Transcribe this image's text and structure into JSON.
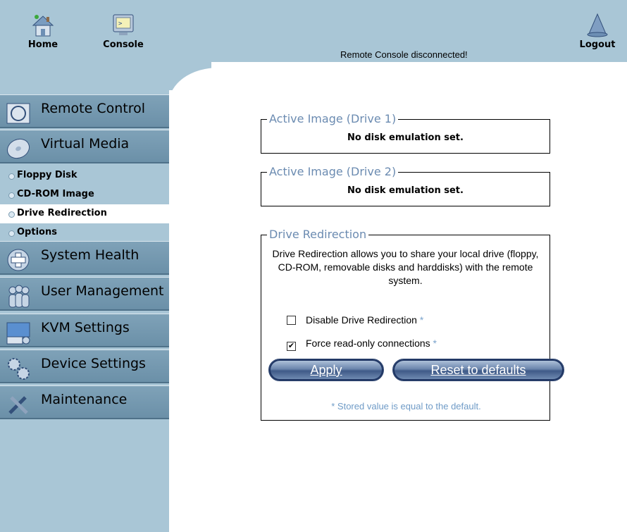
{
  "header": {
    "home_label": "Home",
    "console_label": "Console",
    "logout_label": "Logout",
    "status_text": "Remote Console disconnected!"
  },
  "sidebar": {
    "remote_control": "Remote Control",
    "virtual_media": "Virtual Media",
    "submenu": [
      "Floppy Disk",
      "CD-ROM Image",
      "Drive Redirection",
      "Options"
    ],
    "system_health": "System Health",
    "user_management": "User Management",
    "kvm_settings": "KVM Settings",
    "device_settings": "Device Settings",
    "maintenance": "Maintenance"
  },
  "drive1": {
    "legend": "Active Image (Drive 1)",
    "status": "No disk emulation set."
  },
  "drive2": {
    "legend": "Active Image (Drive 2)",
    "status": "No disk emulation set."
  },
  "redirection": {
    "legend": "Drive Redirection",
    "description": "Drive Redirection allows you to share your local drive (floppy, CD-ROM, removable disks and harddisks) with the remote system.",
    "disable_label": "Disable Drive Redirection",
    "disable_checked": false,
    "readonly_label": "Force read-only connections",
    "readonly_checked": true,
    "star": "*",
    "apply_label": "Apply",
    "reset_label": "Reset to defaults",
    "note": "* Stored value is equal to the default."
  },
  "colors": {
    "header_bg": "#a9c6d6",
    "menu_bg": "#7fa2b8",
    "legend_text": "#6b8bb1",
    "note_text": "#6f9bc7"
  }
}
